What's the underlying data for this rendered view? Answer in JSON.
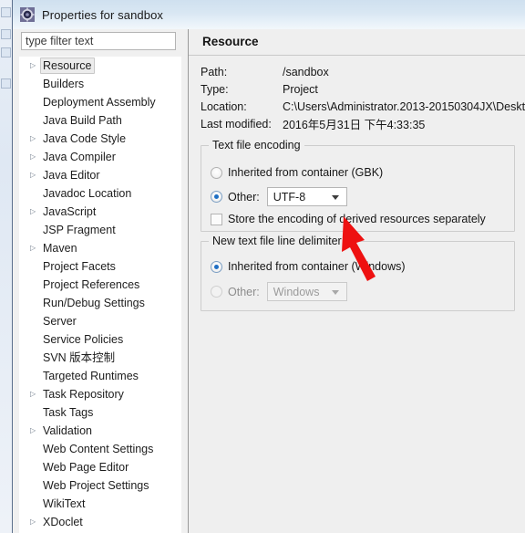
{
  "window": {
    "title": "Properties for sandbox",
    "icon": "properties-gear-icon"
  },
  "filter": {
    "placeholder": "type filter text",
    "value": ""
  },
  "tree": {
    "items": [
      {
        "label": "Resource",
        "expandable": true,
        "selected": true
      },
      {
        "label": "Builders",
        "expandable": false,
        "selected": false
      },
      {
        "label": "Deployment Assembly",
        "expandable": false,
        "selected": false
      },
      {
        "label": "Java Build Path",
        "expandable": false,
        "selected": false
      },
      {
        "label": "Java Code Style",
        "expandable": true,
        "selected": false
      },
      {
        "label": "Java Compiler",
        "expandable": true,
        "selected": false
      },
      {
        "label": "Java Editor",
        "expandable": true,
        "selected": false
      },
      {
        "label": "Javadoc Location",
        "expandable": false,
        "selected": false
      },
      {
        "label": "JavaScript",
        "expandable": true,
        "selected": false
      },
      {
        "label": "JSP Fragment",
        "expandable": false,
        "selected": false
      },
      {
        "label": "Maven",
        "expandable": true,
        "selected": false
      },
      {
        "label": "Project Facets",
        "expandable": false,
        "selected": false
      },
      {
        "label": "Project References",
        "expandable": false,
        "selected": false
      },
      {
        "label": "Run/Debug Settings",
        "expandable": false,
        "selected": false
      },
      {
        "label": "Server",
        "expandable": false,
        "selected": false
      },
      {
        "label": "Service Policies",
        "expandable": false,
        "selected": false
      },
      {
        "label": "SVN 版本控制",
        "expandable": false,
        "selected": false
      },
      {
        "label": "Targeted Runtimes",
        "expandable": false,
        "selected": false
      },
      {
        "label": "Task Repository",
        "expandable": true,
        "selected": false
      },
      {
        "label": "Task Tags",
        "expandable": false,
        "selected": false
      },
      {
        "label": "Validation",
        "expandable": true,
        "selected": false
      },
      {
        "label": "Web Content Settings",
        "expandable": false,
        "selected": false
      },
      {
        "label": "Web Page Editor",
        "expandable": false,
        "selected": false
      },
      {
        "label": "Web Project Settings",
        "expandable": false,
        "selected": false
      },
      {
        "label": "WikiText",
        "expandable": false,
        "selected": false
      },
      {
        "label": "XDoclet",
        "expandable": true,
        "selected": false
      }
    ]
  },
  "page": {
    "title": "Resource",
    "properties": [
      {
        "key": "Path:",
        "value": "/sandbox"
      },
      {
        "key": "Type:",
        "value": "Project"
      },
      {
        "key": "Location:",
        "value": "C:\\Users\\Administrator.2013-20150304JX\\Deskt"
      },
      {
        "key": "Last modified:",
        "value": "2016年5月31日 下午4:33:35"
      }
    ],
    "encoding_group": {
      "title": "Text file encoding",
      "inherited_label": "Inherited from container (GBK)",
      "inherited_selected": false,
      "other_label": "Other:",
      "other_selected": true,
      "other_value": "UTF-8",
      "store_derived_label": "Store the encoding of derived resources separately",
      "store_derived_checked": false
    },
    "delimiter_group": {
      "title": "New text file line delimiter",
      "inherited_label": "Inherited from container (Windows)",
      "inherited_selected": true,
      "other_label": "Other:",
      "other_selected": false,
      "other_value": "Windows",
      "other_disabled": true
    }
  },
  "annotation": {
    "arrow_color": "#ee1111",
    "points_to": "store-derived-resources-checkbox"
  },
  "background_icons": [
    "toolbar-icon-1",
    "toolbar-icon-2",
    "toolbar-icon-3",
    "toolbar-icon-4"
  ]
}
